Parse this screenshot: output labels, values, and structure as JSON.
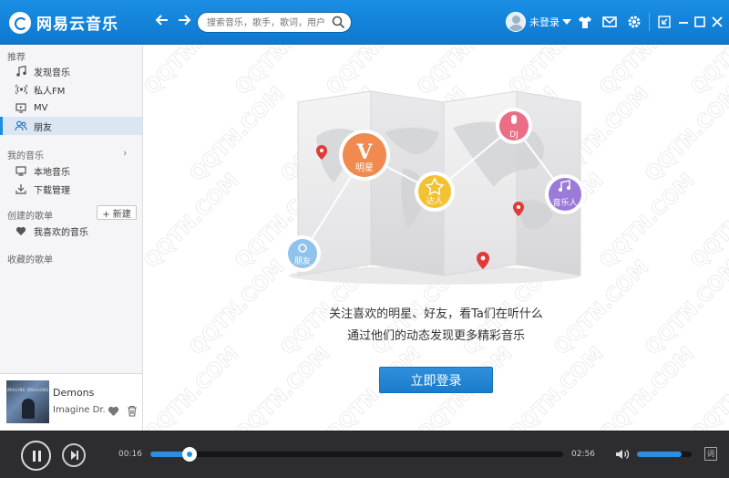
{
  "app": {
    "title": "网易云音乐"
  },
  "search": {
    "placeholder": "搜索音乐，歌手，歌词，用户"
  },
  "user": {
    "name": "未登录"
  },
  "sidebar": {
    "recommend_title": "推荐",
    "recommend_items": [
      {
        "label": "发现音乐",
        "icon": "music-note-icon"
      },
      {
        "label": "私人FM",
        "icon": "radio-icon"
      },
      {
        "label": "MV",
        "icon": "tv-icon"
      },
      {
        "label": "朋友",
        "icon": "friends-icon"
      }
    ],
    "my_music_title": "我的音乐",
    "my_music_items": [
      {
        "label": "本地音乐",
        "icon": "monitor-icon"
      },
      {
        "label": "下载管理",
        "icon": "download-icon"
      }
    ],
    "created_title": "创建的歌单",
    "new_playlist_label": "+ 新建",
    "created_items": [
      {
        "label": "我喜欢的音乐",
        "icon": "heart-icon"
      }
    ],
    "collected_title": "收藏的歌单"
  },
  "now_playing": {
    "title": "Demons",
    "artist": "Imagine Dr...",
    "album_band_text": "IMAGINE DRAGONS"
  },
  "main": {
    "illustration_labels": {
      "star": "明星",
      "friend": "朋友",
      "talent": "达人",
      "dj": "DJ",
      "musician": "音乐人"
    },
    "line1": "关注喜欢的明星、好友，看Ta们在听什么",
    "line2": "通过他们的动态发现更多精彩音乐",
    "login_label": "立即登录",
    "watermark_text": "QQTN.COM"
  },
  "player": {
    "current_time": "00:16",
    "total_time": "02:56",
    "progress_fraction": 0.095,
    "volume_fraction": 0.82,
    "lyric_label": "词"
  },
  "colors": {
    "accent": "#1a8ee3",
    "player_bg": "#2d2d2f",
    "pin": "#e23a3a"
  }
}
